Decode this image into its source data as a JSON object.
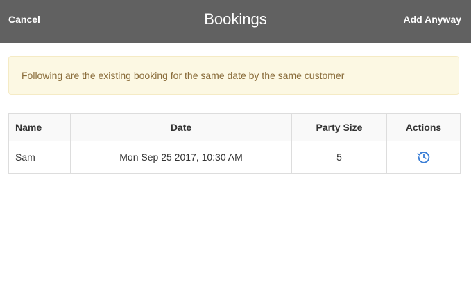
{
  "header": {
    "cancel_label": "Cancel",
    "title": "Bookings",
    "add_label": "Add Anyway"
  },
  "alert": {
    "message": "Following are the existing booking for the same date by the same customer"
  },
  "table": {
    "columns": [
      "Name",
      "Date",
      "Party Size",
      "Actions"
    ],
    "rows": [
      {
        "name": "Sam",
        "date": "Mon Sep 25 2017, 10:30 AM",
        "party_size": "5",
        "action_icon": "restore-icon"
      }
    ]
  },
  "colors": {
    "header_bg": "#616161",
    "alert_bg": "#fcf8e3",
    "alert_text": "#8a6d3b",
    "icon_accent": "#3c7fd6"
  }
}
